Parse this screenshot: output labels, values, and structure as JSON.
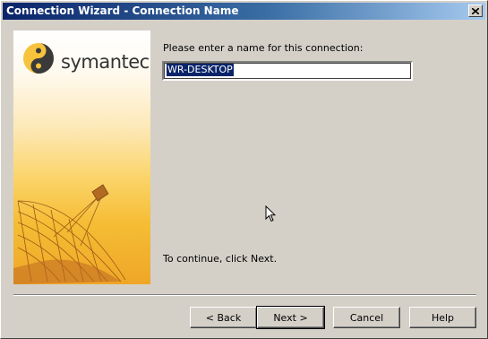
{
  "window": {
    "title": "Connection Wizard - Connection Name",
    "close_label": "×"
  },
  "side_panel": {
    "brand": "symantec."
  },
  "form": {
    "prompt": "Please enter a name for this connection:",
    "name_value": "WR-DESKTOP",
    "continue_hint": "To continue, click Next."
  },
  "buttons": {
    "back": "< Back",
    "next": "Next >",
    "cancel": "Cancel",
    "help": "Help"
  },
  "colors": {
    "titlebar_start": "#0a246a",
    "titlebar_end": "#a6caf0",
    "selection": "#0a246a",
    "panel_gold": "#f5bd34"
  },
  "icons": {
    "logo": "symantec-logo-icon",
    "dish": "satellite-dish-icon",
    "close": "close-icon",
    "cursor": "mouse-cursor-icon"
  }
}
